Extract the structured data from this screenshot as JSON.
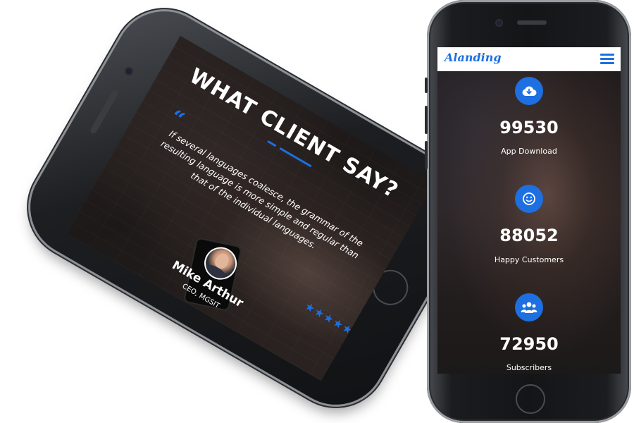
{
  "testimonial": {
    "title": "WHAT CLIENT SAY?",
    "quote_mark": "“",
    "quote": "If several languages coalesce, the grammar of the resulting language is more simple and regular than that of the individual languages.",
    "rating": 5,
    "stars": "★★★★★",
    "name": "Mike Arthur",
    "role": "CEO, MGSIT"
  },
  "navbar": {
    "logo": "Alanding",
    "menu_icon": "hamburger-menu-icon"
  },
  "stats": [
    {
      "icon": "cloud-download-icon",
      "value": "99530",
      "label": "App Download"
    },
    {
      "icon": "smile-icon",
      "value": "88052",
      "label": "Happy Customers"
    },
    {
      "icon": "users-icon",
      "value": "72950",
      "label": "Subscribers"
    }
  ],
  "colors": {
    "accent": "#1e6fe0",
    "phone_body": "#141517",
    "text": "#ffffff"
  }
}
